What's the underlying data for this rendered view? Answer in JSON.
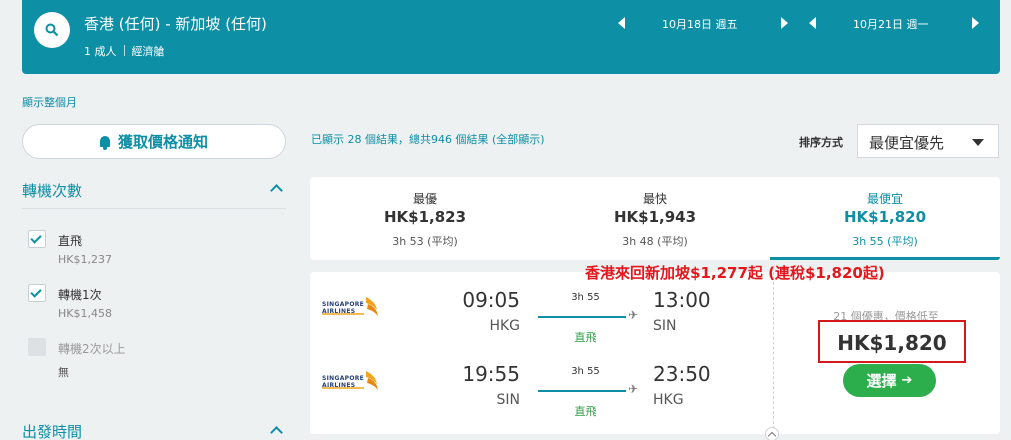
{
  "search": {
    "route": "香港 (任何) - 新加坡 (任何)",
    "passengers": "1 成人",
    "cabin": "經濟艙",
    "depart_date": "10月18日 週五",
    "return_date": "10月21日 週一"
  },
  "sidebar": {
    "month_link": "顯示整個月",
    "price_alert_button": "獲取價格通知",
    "stops": {
      "title": "轉機次數",
      "options": [
        {
          "label": "直飛",
          "price": "HK$1,237",
          "checked": true
        },
        {
          "label": "轉機1次",
          "price": "HK$1,458",
          "checked": true
        },
        {
          "label": "轉機2次以上",
          "price": "無",
          "checked": false
        }
      ]
    },
    "departure_time_title": "出發時間"
  },
  "results": {
    "count_text": "已顯示 28 個結果，總共946 個結果 (全部顯示)",
    "sort_label": "排序方式",
    "sort_value": "最便宜優先"
  },
  "summary_tabs": [
    {
      "label": "最優",
      "price": "HK$1,823",
      "avg": "3h 53 (平均)"
    },
    {
      "label": "最快",
      "price": "HK$1,943",
      "avg": "3h 48 (平均)"
    },
    {
      "label": "最便宜",
      "price": "HK$1,820",
      "avg": "3h 55 (平均)",
      "active": true
    }
  ],
  "flight": {
    "airline": "SINGAPORE AIRLINES",
    "outbound": {
      "dep_time": "09:05",
      "dep_code": "HKG",
      "arr_time": "13:00",
      "arr_code": "SIN",
      "duration": "3h 55",
      "stops": "直飛"
    },
    "inbound": {
      "dep_time": "19:55",
      "dep_code": "SIN",
      "arr_time": "23:50",
      "arr_code": "HKG",
      "duration": "3h 55",
      "stops": "直飛"
    },
    "deals_text": "21 個優惠，價格低至",
    "price": "HK$1,820",
    "select_button": "選擇",
    "select_arrow": "➔",
    "plane_glyph": "✈"
  },
  "annotation": "香港來回新加坡$1,277起 (連稅$1,820起)",
  "colors": {
    "accent": "#0d8fa5",
    "select_green": "#2dae4d",
    "highlight_red": "#d4191d"
  }
}
